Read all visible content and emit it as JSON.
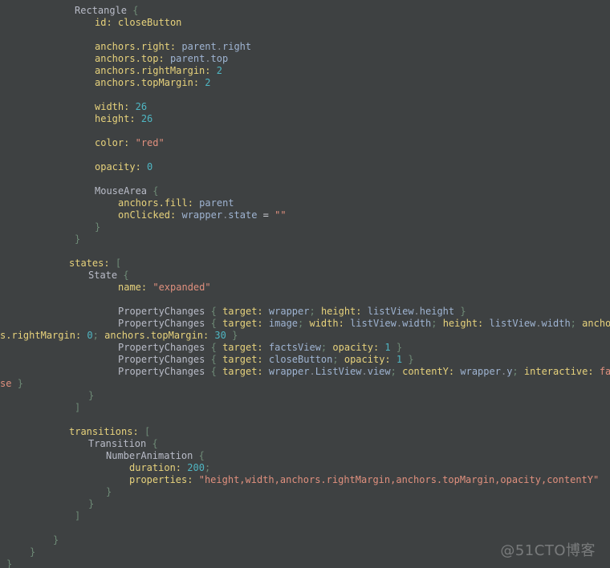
{
  "editor": {
    "language": "QML",
    "background_color": "#3e4142",
    "colors": {
      "type": "#b9bcc8",
      "property": "#e7d27c",
      "identifier": "#9fb4d2",
      "string": "#e0907e",
      "number": "#4fb6c3",
      "keyword": "#e0907e",
      "punctuation": "#6e8a76",
      "operator": "#c9ccd2"
    },
    "lines": [
      {
        "indent": 93,
        "tokens": [
          {
            "t": "Rectangle",
            "c": "typ"
          },
          {
            "t": " ",
            "c": "plain"
          },
          {
            "t": "{",
            "c": "punc"
          }
        ]
      },
      {
        "indent": 118,
        "tokens": [
          {
            "t": "id:",
            "c": "prop"
          },
          {
            "t": " ",
            "c": "plain"
          },
          {
            "t": "closeButton",
            "c": "prop"
          }
        ]
      },
      {
        "indent": 0,
        "tokens": []
      },
      {
        "indent": 118,
        "tokens": [
          {
            "t": "anchors",
            "c": "prop"
          },
          {
            "t": ".",
            "c": "prop"
          },
          {
            "t": "right:",
            "c": "prop"
          },
          {
            "t": " ",
            "c": "plain"
          },
          {
            "t": "parent",
            "c": "ident"
          },
          {
            "t": ".",
            "c": "dot"
          },
          {
            "t": "right",
            "c": "ident"
          }
        ]
      },
      {
        "indent": 118,
        "tokens": [
          {
            "t": "anchors",
            "c": "prop"
          },
          {
            "t": ".",
            "c": "prop"
          },
          {
            "t": "top:",
            "c": "prop"
          },
          {
            "t": " ",
            "c": "plain"
          },
          {
            "t": "parent",
            "c": "ident"
          },
          {
            "t": ".",
            "c": "dot"
          },
          {
            "t": "top",
            "c": "ident"
          }
        ]
      },
      {
        "indent": 118,
        "tokens": [
          {
            "t": "anchors",
            "c": "prop"
          },
          {
            "t": ".",
            "c": "prop"
          },
          {
            "t": "rightMargin:",
            "c": "prop"
          },
          {
            "t": " ",
            "c": "plain"
          },
          {
            "t": "2",
            "c": "num"
          }
        ]
      },
      {
        "indent": 118,
        "tokens": [
          {
            "t": "anchors",
            "c": "prop"
          },
          {
            "t": ".",
            "c": "prop"
          },
          {
            "t": "topMargin:",
            "c": "prop"
          },
          {
            "t": " ",
            "c": "plain"
          },
          {
            "t": "2",
            "c": "num"
          }
        ]
      },
      {
        "indent": 0,
        "tokens": []
      },
      {
        "indent": 118,
        "tokens": [
          {
            "t": "width:",
            "c": "prop"
          },
          {
            "t": " ",
            "c": "plain"
          },
          {
            "t": "26",
            "c": "num"
          }
        ]
      },
      {
        "indent": 118,
        "tokens": [
          {
            "t": "height:",
            "c": "prop"
          },
          {
            "t": " ",
            "c": "plain"
          },
          {
            "t": "26",
            "c": "num"
          }
        ]
      },
      {
        "indent": 0,
        "tokens": []
      },
      {
        "indent": 118,
        "tokens": [
          {
            "t": "color:",
            "c": "prop"
          },
          {
            "t": " ",
            "c": "plain"
          },
          {
            "t": "\"red\"",
            "c": "str"
          }
        ]
      },
      {
        "indent": 0,
        "tokens": []
      },
      {
        "indent": 118,
        "tokens": [
          {
            "t": "opacity:",
            "c": "prop"
          },
          {
            "t": " ",
            "c": "plain"
          },
          {
            "t": "0",
            "c": "num"
          }
        ]
      },
      {
        "indent": 0,
        "tokens": []
      },
      {
        "indent": 118,
        "tokens": [
          {
            "t": "MouseArea",
            "c": "typ"
          },
          {
            "t": " ",
            "c": "plain"
          },
          {
            "t": "{",
            "c": "punc"
          }
        ]
      },
      {
        "indent": 147,
        "tokens": [
          {
            "t": "anchors",
            "c": "prop"
          },
          {
            "t": ".",
            "c": "prop"
          },
          {
            "t": "fill:",
            "c": "prop"
          },
          {
            "t": " ",
            "c": "plain"
          },
          {
            "t": "parent",
            "c": "ident"
          }
        ]
      },
      {
        "indent": 147,
        "tokens": [
          {
            "t": "onClicked:",
            "c": "prop"
          },
          {
            "t": " ",
            "c": "plain"
          },
          {
            "t": "wrapper",
            "c": "ident"
          },
          {
            "t": ".",
            "c": "dot"
          },
          {
            "t": "state",
            "c": "ident"
          },
          {
            "t": " ",
            "c": "plain"
          },
          {
            "t": "=",
            "c": "op"
          },
          {
            "t": " ",
            "c": "plain"
          },
          {
            "t": "\"\"",
            "c": "str"
          }
        ]
      },
      {
        "indent": 118,
        "tokens": [
          {
            "t": "}",
            "c": "punc"
          }
        ]
      },
      {
        "indent": 93,
        "tokens": [
          {
            "t": "}",
            "c": "punc"
          }
        ]
      },
      {
        "indent": 0,
        "tokens": []
      },
      {
        "indent": 86,
        "tokens": [
          {
            "t": "states:",
            "c": "prop"
          },
          {
            "t": " ",
            "c": "plain"
          },
          {
            "t": "[",
            "c": "punc"
          }
        ]
      },
      {
        "indent": 110,
        "tokens": [
          {
            "t": "State",
            "c": "typ"
          },
          {
            "t": " ",
            "c": "plain"
          },
          {
            "t": "{",
            "c": "punc"
          }
        ]
      },
      {
        "indent": 147,
        "tokens": [
          {
            "t": "name:",
            "c": "prop"
          },
          {
            "t": " ",
            "c": "plain"
          },
          {
            "t": "\"expanded\"",
            "c": "str"
          }
        ]
      },
      {
        "indent": 0,
        "tokens": []
      },
      {
        "indent": 147,
        "tokens": [
          {
            "t": "PropertyChanges",
            "c": "typ"
          },
          {
            "t": " ",
            "c": "plain"
          },
          {
            "t": "{",
            "c": "punc"
          },
          {
            "t": " ",
            "c": "plain"
          },
          {
            "t": "target:",
            "c": "prop"
          },
          {
            "t": " ",
            "c": "plain"
          },
          {
            "t": "wrapper",
            "c": "ident"
          },
          {
            "t": ";",
            "c": "punc"
          },
          {
            "t": " ",
            "c": "plain"
          },
          {
            "t": "height:",
            "c": "prop"
          },
          {
            "t": " ",
            "c": "plain"
          },
          {
            "t": "listView",
            "c": "ident"
          },
          {
            "t": ".",
            "c": "dot"
          },
          {
            "t": "height",
            "c": "ident"
          },
          {
            "t": " ",
            "c": "plain"
          },
          {
            "t": "}",
            "c": "punc"
          }
        ]
      },
      {
        "indent": 147,
        "tokens": [
          {
            "t": "PropertyChanges",
            "c": "typ"
          },
          {
            "t": " ",
            "c": "plain"
          },
          {
            "t": "{",
            "c": "punc"
          },
          {
            "t": " ",
            "c": "plain"
          },
          {
            "t": "target:",
            "c": "prop"
          },
          {
            "t": " ",
            "c": "plain"
          },
          {
            "t": "image",
            "c": "ident"
          },
          {
            "t": ";",
            "c": "punc"
          },
          {
            "t": " ",
            "c": "plain"
          },
          {
            "t": "width:",
            "c": "prop"
          },
          {
            "t": " ",
            "c": "plain"
          },
          {
            "t": "listView",
            "c": "ident"
          },
          {
            "t": ".",
            "c": "dot"
          },
          {
            "t": "width",
            "c": "ident"
          },
          {
            "t": ";",
            "c": "punc"
          },
          {
            "t": " ",
            "c": "plain"
          },
          {
            "t": "height:",
            "c": "prop"
          },
          {
            "t": " ",
            "c": "plain"
          },
          {
            "t": "listView",
            "c": "ident"
          },
          {
            "t": ".",
            "c": "dot"
          },
          {
            "t": "width",
            "c": "ident"
          },
          {
            "t": ";",
            "c": "punc"
          },
          {
            "t": " ",
            "c": "plain"
          },
          {
            "t": "anchor",
            "c": "prop"
          }
        ]
      },
      {
        "indent": 0,
        "tokens": [
          {
            "t": "s",
            "c": "prop"
          },
          {
            "t": ".",
            "c": "prop"
          },
          {
            "t": "rightMargin:",
            "c": "prop"
          },
          {
            "t": " ",
            "c": "plain"
          },
          {
            "t": "0",
            "c": "num"
          },
          {
            "t": ";",
            "c": "punc"
          },
          {
            "t": " ",
            "c": "plain"
          },
          {
            "t": "anchors",
            "c": "prop"
          },
          {
            "t": ".",
            "c": "prop"
          },
          {
            "t": "topMargin:",
            "c": "prop"
          },
          {
            "t": " ",
            "c": "plain"
          },
          {
            "t": "30",
            "c": "num"
          },
          {
            "t": " ",
            "c": "plain"
          },
          {
            "t": "}",
            "c": "punc"
          }
        ]
      },
      {
        "indent": 147,
        "tokens": [
          {
            "t": "PropertyChanges",
            "c": "typ"
          },
          {
            "t": " ",
            "c": "plain"
          },
          {
            "t": "{",
            "c": "punc"
          },
          {
            "t": " ",
            "c": "plain"
          },
          {
            "t": "target:",
            "c": "prop"
          },
          {
            "t": " ",
            "c": "plain"
          },
          {
            "t": "factsView",
            "c": "ident"
          },
          {
            "t": ";",
            "c": "punc"
          },
          {
            "t": " ",
            "c": "plain"
          },
          {
            "t": "opacity:",
            "c": "prop"
          },
          {
            "t": " ",
            "c": "plain"
          },
          {
            "t": "1",
            "c": "num"
          },
          {
            "t": " ",
            "c": "plain"
          },
          {
            "t": "}",
            "c": "punc"
          }
        ]
      },
      {
        "indent": 147,
        "tokens": [
          {
            "t": "PropertyChanges",
            "c": "typ"
          },
          {
            "t": " ",
            "c": "plain"
          },
          {
            "t": "{",
            "c": "punc"
          },
          {
            "t": " ",
            "c": "plain"
          },
          {
            "t": "target:",
            "c": "prop"
          },
          {
            "t": " ",
            "c": "plain"
          },
          {
            "t": "closeButton",
            "c": "ident"
          },
          {
            "t": ";",
            "c": "punc"
          },
          {
            "t": " ",
            "c": "plain"
          },
          {
            "t": "opacity:",
            "c": "prop"
          },
          {
            "t": " ",
            "c": "plain"
          },
          {
            "t": "1",
            "c": "num"
          },
          {
            "t": " ",
            "c": "plain"
          },
          {
            "t": "}",
            "c": "punc"
          }
        ]
      },
      {
        "indent": 147,
        "tokens": [
          {
            "t": "PropertyChanges",
            "c": "typ"
          },
          {
            "t": " ",
            "c": "plain"
          },
          {
            "t": "{",
            "c": "punc"
          },
          {
            "t": " ",
            "c": "plain"
          },
          {
            "t": "target:",
            "c": "prop"
          },
          {
            "t": " ",
            "c": "plain"
          },
          {
            "t": "wrapper",
            "c": "ident"
          },
          {
            "t": ".",
            "c": "dot"
          },
          {
            "t": "ListView",
            "c": "ident"
          },
          {
            "t": ".",
            "c": "dot"
          },
          {
            "t": "view",
            "c": "ident"
          },
          {
            "t": ";",
            "c": "punc"
          },
          {
            "t": " ",
            "c": "plain"
          },
          {
            "t": "contentY:",
            "c": "prop"
          },
          {
            "t": " ",
            "c": "plain"
          },
          {
            "t": "wrapper",
            "c": "ident"
          },
          {
            "t": ".",
            "c": "dot"
          },
          {
            "t": "y",
            "c": "ident"
          },
          {
            "t": ";",
            "c": "punc"
          },
          {
            "t": " ",
            "c": "plain"
          },
          {
            "t": "interactive:",
            "c": "prop"
          },
          {
            "t": " ",
            "c": "plain"
          },
          {
            "t": "fal",
            "c": "kw"
          }
        ]
      },
      {
        "indent": 0,
        "tokens": [
          {
            "t": "se",
            "c": "kw"
          },
          {
            "t": " ",
            "c": "plain"
          },
          {
            "t": "}",
            "c": "punc"
          }
        ]
      },
      {
        "indent": 110,
        "tokens": [
          {
            "t": "}",
            "c": "punc"
          }
        ]
      },
      {
        "indent": 93,
        "tokens": [
          {
            "t": "]",
            "c": "punc"
          }
        ]
      },
      {
        "indent": 0,
        "tokens": []
      },
      {
        "indent": 86,
        "tokens": [
          {
            "t": "transitions:",
            "c": "prop"
          },
          {
            "t": " ",
            "c": "plain"
          },
          {
            "t": "[",
            "c": "punc"
          }
        ]
      },
      {
        "indent": 110,
        "tokens": [
          {
            "t": "Transition",
            "c": "typ"
          },
          {
            "t": " ",
            "c": "plain"
          },
          {
            "t": "{",
            "c": "punc"
          }
        ]
      },
      {
        "indent": 132,
        "tokens": [
          {
            "t": "NumberAnimation",
            "c": "typ"
          },
          {
            "t": " ",
            "c": "plain"
          },
          {
            "t": "{",
            "c": "punc"
          }
        ]
      },
      {
        "indent": 161,
        "tokens": [
          {
            "t": "duration:",
            "c": "prop"
          },
          {
            "t": " ",
            "c": "plain"
          },
          {
            "t": "200",
            "c": "num"
          },
          {
            "t": ";",
            "c": "punc"
          }
        ]
      },
      {
        "indent": 161,
        "tokens": [
          {
            "t": "properties:",
            "c": "prop"
          },
          {
            "t": " ",
            "c": "plain"
          },
          {
            "t": "\"height,width,anchors.rightMargin,anchors.topMargin,opacity,contentY\"",
            "c": "str"
          }
        ]
      },
      {
        "indent": 132,
        "tokens": [
          {
            "t": "}",
            "c": "punc"
          }
        ]
      },
      {
        "indent": 110,
        "tokens": [
          {
            "t": "}",
            "c": "punc"
          }
        ]
      },
      {
        "indent": 93,
        "tokens": [
          {
            "t": "]",
            "c": "punc"
          }
        ]
      },
      {
        "indent": 0,
        "tokens": []
      },
      {
        "indent": 66,
        "tokens": [
          {
            "t": "}",
            "c": "punc"
          }
        ]
      },
      {
        "indent": 37,
        "tokens": [
          {
            "t": "}",
            "c": "punc"
          }
        ]
      },
      {
        "indent": 8,
        "tokens": [
          {
            "t": "}",
            "c": "punc"
          }
        ]
      }
    ]
  },
  "watermark": {
    "text": "@51CTO博客"
  }
}
